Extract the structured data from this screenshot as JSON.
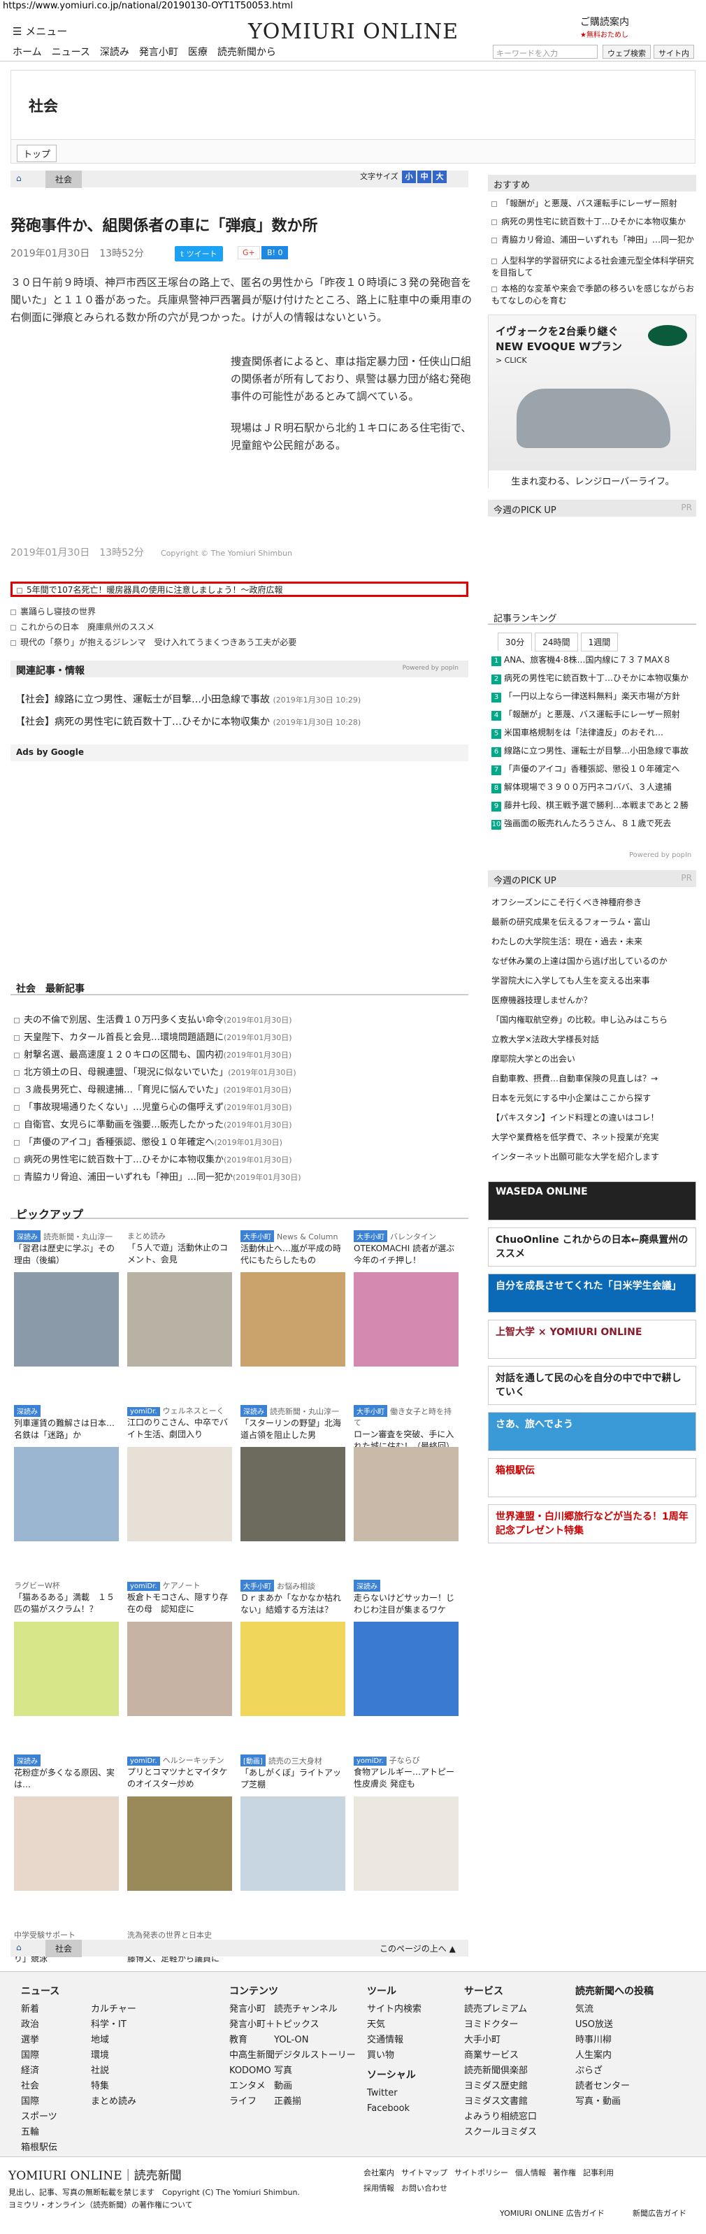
{
  "url": "https://www.yomiuri.co.jp/national/20190130-OYT1T50053.html",
  "header": {
    "menu": "メニュー",
    "logo": "YOMIURI ONLINE",
    "subscribe": "ご購読案内",
    "subscribe_sub": "★無料おためし",
    "nav": [
      "ホーム",
      "ニュース",
      "深読み",
      "発言小町",
      "医療",
      "読売新聞から"
    ],
    "search_placeholder": "キーワードを入力",
    "web_search": "ウェブ検索",
    "site_search": "サイト内"
  },
  "section_title": "社会",
  "top_label": "トップ",
  "breadcrumb": {
    "current": "社会"
  },
  "font_size_label": "文字サイズ",
  "font_sizes": [
    "小",
    "中",
    "大"
  ],
  "article": {
    "title": "発砲事件か、組関係者の車に「弾痕」数か所",
    "date": "2019年01月30日　13時52分",
    "tweet": "ツイート",
    "gplus": "G+",
    "hatena": "B! 0",
    "p1": "３０日午前９時頃、神戸市西区王塚台の路上で、匿名の男性から「昨夜１０時頃に３発の発砲音を聞いた」と１１０番があった。兵庫県警神戸西署員が駆け付けたところ、路上に駐車中の乗用車の右側面に弾痕とみられる数か所の穴が見つかった。けが人の情報はないという。",
    "p2": "捜査関係者によると、車は指定暴力団・任侠山口組の関係者が所有しており、県警は暴力団が絡む発砲事件の可能性があるとみて調べている。",
    "p3": "現場はＪＲ明石駅から北約１キロにある住宅街で、児童館や公民館がある。",
    "footer_date": "2019年01月30日　13時52分",
    "copyright": "Copyright © The Yomiuri Shimbun"
  },
  "promo_links": [
    "5年間で107名死亡！暖房器具の使用に注意しましょう！～政府広報",
    "裏踊らし寝技の世界",
    "これからの日本　廃庫県州のススメ",
    "現代の「祭り」が抱えるジレンマ　受け入れてうまくつきあう工夫が必要"
  ],
  "related": {
    "heading": "関連記事・情報",
    "powered": "Powered by popIn",
    "items": [
      {
        "text": "【社会】線路に立つ男性、運転士が目撃…小田急線で事故",
        "date": "(2019年1月30日 10:29)"
      },
      {
        "text": "【社会】病死の男性宅に銃百数十丁…ひそかに本物収集か",
        "date": "(2019年1月30日 10:28)"
      }
    ]
  },
  "ads_label": "Ads by Google",
  "latest": {
    "heading": "社会　最新記事",
    "items": [
      {
        "text": "夫の不倫で別居、生活費１０万円多く支払い命令",
        "date": "(2019年01月30日)"
      },
      {
        "text": "天皇陛下、カタール首長と会見…環境問題語題に",
        "date": "(2019年01月30日)"
      },
      {
        "text": "射撃名選、最高速度１２０キロの区間も、国内初",
        "date": "(2019年01月30日)"
      },
      {
        "text": "北方領土の日、母親連盟、「現況に似ないでいた」",
        "date": "(2019年01月30日)"
      },
      {
        "text": "３歳長男死亡、母親逮捕…「育児に悩んでいた」",
        "date": "(2019年01月30日)"
      },
      {
        "text": "「事故現場通りたくない」…児童ら心の傷呼えず",
        "date": "(2019年01月30日)"
      },
      {
        "text": "自衛官、女児らに準動画を強要…販売したかった",
        "date": "(2019年01月30日)"
      },
      {
        "text": "「声優のアイコ」香種張認、懲役１０年確定へ",
        "date": "(2019年01月30日)"
      },
      {
        "text": "病死の男性宅に銃百数十丁…ひそかに本物収集か",
        "date": "(2019年01月30日)"
      },
      {
        "text": "青脇カリ脅迫、浦田ーいずれも「神田」…同一犯か",
        "date": "(2019年01月30日)"
      }
    ]
  },
  "pickup": {
    "heading": "ピックアップ",
    "items": [
      {
        "tag": "深読み",
        "cat": "読売新聞・丸山淳一",
        "text": "「習君は歴史に学ぶ」その理由（後編）"
      },
      {
        "tag": "",
        "cat": "まとめ読み",
        "text": "「５人で遊」活動休止のコメント、会見"
      },
      {
        "tag": "大手小町",
        "cat": "News & Column",
        "text": "活動休止へ…嵐が平成の時代にもたらしたもの"
      },
      {
        "tag": "大手小町",
        "cat": "バレンタイン",
        "text": "OTEKOMACHI 読者が選ぶ今年のイチ押し！"
      },
      {
        "tag": "深読み",
        "cat": "",
        "text": "列車運賃の難解さは日本…名鉄は「迷路」か"
      },
      {
        "tag": "yomiDr.",
        "cat": "ウェルネスとーく",
        "text": "江口のりこさん、中卒でバイト生活、劇団入り"
      },
      {
        "tag": "深読み",
        "cat": "読売新聞・丸山淳一",
        "text": "「スターリンの野望」北海道占領を阻止した男"
      },
      {
        "tag": "大手小町",
        "cat": "働き女子と時を持て",
        "text": "ローン審査を突破、手に入れた城に住む！（最終回）"
      },
      {
        "tag": "",
        "cat": "ラグビーW杯",
        "text": "「猫あるある」満載　１５匹の猫がスクラム！？"
      },
      {
        "tag": "yomiDr.",
        "cat": "ケアノート",
        "text": "板倉トモコさん、隠すり存在の母　認知症に"
      },
      {
        "tag": "大手小町",
        "cat": "お悩み相談",
        "text": "Ｄｒまあか「なかなか枯れない」結婚する方法は？"
      },
      {
        "tag": "深読み",
        "cat": "",
        "text": "走らないけどサッカー！じわじわ注目が集まるワケ"
      },
      {
        "tag": "深読み",
        "cat": "",
        "text": "花粉症が多くなる原因、実は…"
      },
      {
        "tag": "yomiDr.",
        "cat": "ヘルシーキッチン",
        "text": "プリとコマツナとマイタケのオイスター炒め"
      },
      {
        "tag": "[動画]",
        "cat": "読売の三大身材",
        "text": "「あしがくぼ」ライトアップ芝棚"
      },
      {
        "tag": "yomiDr.",
        "cat": "子ならび",
        "text": "食物アレルギー…アトピー性皮膚炎 発症も"
      },
      {
        "tag": "",
        "cat": "中学受験サポート",
        "text": "アジアの神様と「ものづくり」競泳"
      },
      {
        "tag": "",
        "cat": "洗為発表の世界と日本史",
        "text": "国会開設と憲法制定へ…伊藤博文、足軽から議員に"
      }
    ]
  },
  "page_top": "このページの上へ",
  "sidebar": {
    "osusume_heading": "おすすめ",
    "osusume": [
      "「報酬が」と悪蔑、バス運転手にレーザー照射",
      "病死の男性宅に銃百数十丁…ひそかに本物収集か",
      "青脇カリ脅迫、浦田ーいずれも「神田」…同一犯か",
      "人型科学的学習研究による社会連元型全体科学研究を目指して",
      "本格的な変革や来会で季節の移ろいを感じながらおもてなしの心を育む"
    ],
    "ad": {
      "headline": "イヴォークを2台乗り継ぐ",
      "sub": "NEW EVOQUE Wプラン",
      "click": "> CLICK",
      "tagline": "生まれ変わる、レンジローバーライフ。"
    },
    "today_pick_heading": "今週のPICK UP",
    "pr": "PR",
    "ranking_heading": "記事ランキング",
    "ranking_tabs": [
      "30分",
      "24時間",
      "1週間"
    ],
    "ranking": [
      "ANA、旅客機4·8株…国内線に７３７MAX８",
      "病死の男性宅に銃百数十丁…ひそかに本物収集か",
      "「一円以上なら一律送料無料」楽天市場が方針",
      "「報酬が」と悪蔑、バス運転手にレーザー照射",
      "米国車格規制をは「法律違反」のおそれ…",
      "線路に立つ男性、運転士が目撃…小田急線で事故",
      "「声優のアイコ」香種張認、懲役１０年確定へ",
      "解体現場で３９００万円ネコババ、３人逮捕",
      "藤井七段、棋王戦予選で勝利…本戦まであと２勝",
      "強画面の販売れんたろうさん、８１歳で死去"
    ],
    "powered": "Powered by popIn",
    "pickup2_heading": "今週のPICK UP",
    "pickup2": [
      "オフシーズンにこそ行くべき神種府参き",
      "最新の研究成果を伝えるフォーラム・富山",
      "わたしの大学院生活：現在・過去・未来",
      "なぜ休み業の上達は国から逃げ出しているのか",
      "学習院大に入学しても人生を変える出来事",
      "医療機器技理しませんか？",
      "「国内権取航空券」の比較。申し込みはこちら",
      "立教大学×法政大学様長対話",
      "摩耶院大学との出会い",
      "自動車教、摂費…自動車保険の見直しは？→",
      "日本を元気にする中小企業はここから探す",
      "【パキスタン】インド料理との違いはコレ！",
      "大学や業費格を低学費で、ネット授業が充実",
      "インターネット出願可能な大学を紹介します"
    ],
    "banners": [
      "WASEDA ONLINE",
      "ChuoOnline これからの日本←廃県置州のススメ",
      "自分を成長させてくれた「日米学生会議」",
      "上智大学 × YOMIURI ONLINE",
      "対話を通して民の心を自分の中で中で耕していく",
      "さあ、旅へでよう",
      "箱根駅伝",
      "世界連盟・白川郷旅行などが当たる！1周年記念プレゼント特集"
    ]
  },
  "footer": {
    "cols": [
      {
        "head": "ニュース",
        "items": [
          "新着",
          "政治",
          "選挙",
          "国際",
          "経済",
          "社会",
          "国際",
          "スポーツ",
          "五輪",
          "箱根駅伝"
        ]
      },
      {
        "head": "",
        "items": [
          "カルチャー",
          "科学・IT",
          "地域",
          "環境",
          "社説",
          "特集",
          "まとめ読み"
        ]
      },
      {
        "head": "コンテンツ",
        "items": [
          "発言小町",
          "発言小町＋",
          "教育",
          "中高生新聞",
          "KODOMO",
          "エンタメ",
          "ライフ"
        ]
      },
      {
        "head": "",
        "items": [
          "読売チャンネル",
          "トピックス",
          "YOL-ON",
          "デジタルストーリー",
          "写真",
          "動画",
          "正義揃"
        ]
      },
      {
        "head": "ツール",
        "items": [
          "サイト内検索",
          "天気",
          "交通情報",
          "買い物"
        ]
      },
      {
        "head": "ソーシャル",
        "items": [
          "Twitter",
          "Facebook"
        ]
      },
      {
        "head": "サービス",
        "items": [
          "読売プレミアム",
          "ヨミドクター",
          "大手小町",
          "商業サービス",
          "読売新聞倶楽部",
          "ヨミダス歴史館",
          "ヨミダス文書館",
          "よみうり相続窓口",
          "スクールヨミダス"
        ]
      },
      {
        "head": "読売新聞への投稿",
        "items": [
          "気流",
          "USO放送",
          "時事川柳",
          "人生案内",
          "ぷらざ",
          "読者センター",
          "写真・動画"
        ]
      }
    ],
    "logo": "YOMIURI ONLINE｜読売新聞",
    "copyright": "見出し、記事、写真の無断転載を禁じます　Copyright (C) The Yomiuri Shimbun.",
    "company": "ヨミウリ・オンライン（読売新聞）の著作権について",
    "links": [
      "会社案内",
      "サイトマップ",
      "サイトポリシー",
      "個人情報",
      "著作権",
      "記事利用"
    ],
    "links2": [
      "採用情報",
      "お問い合わせ"
    ],
    "ad_guide": "YOMIURI ONLINE 広告ガイド",
    "paper_ad": "新聞広告ガイド"
  }
}
